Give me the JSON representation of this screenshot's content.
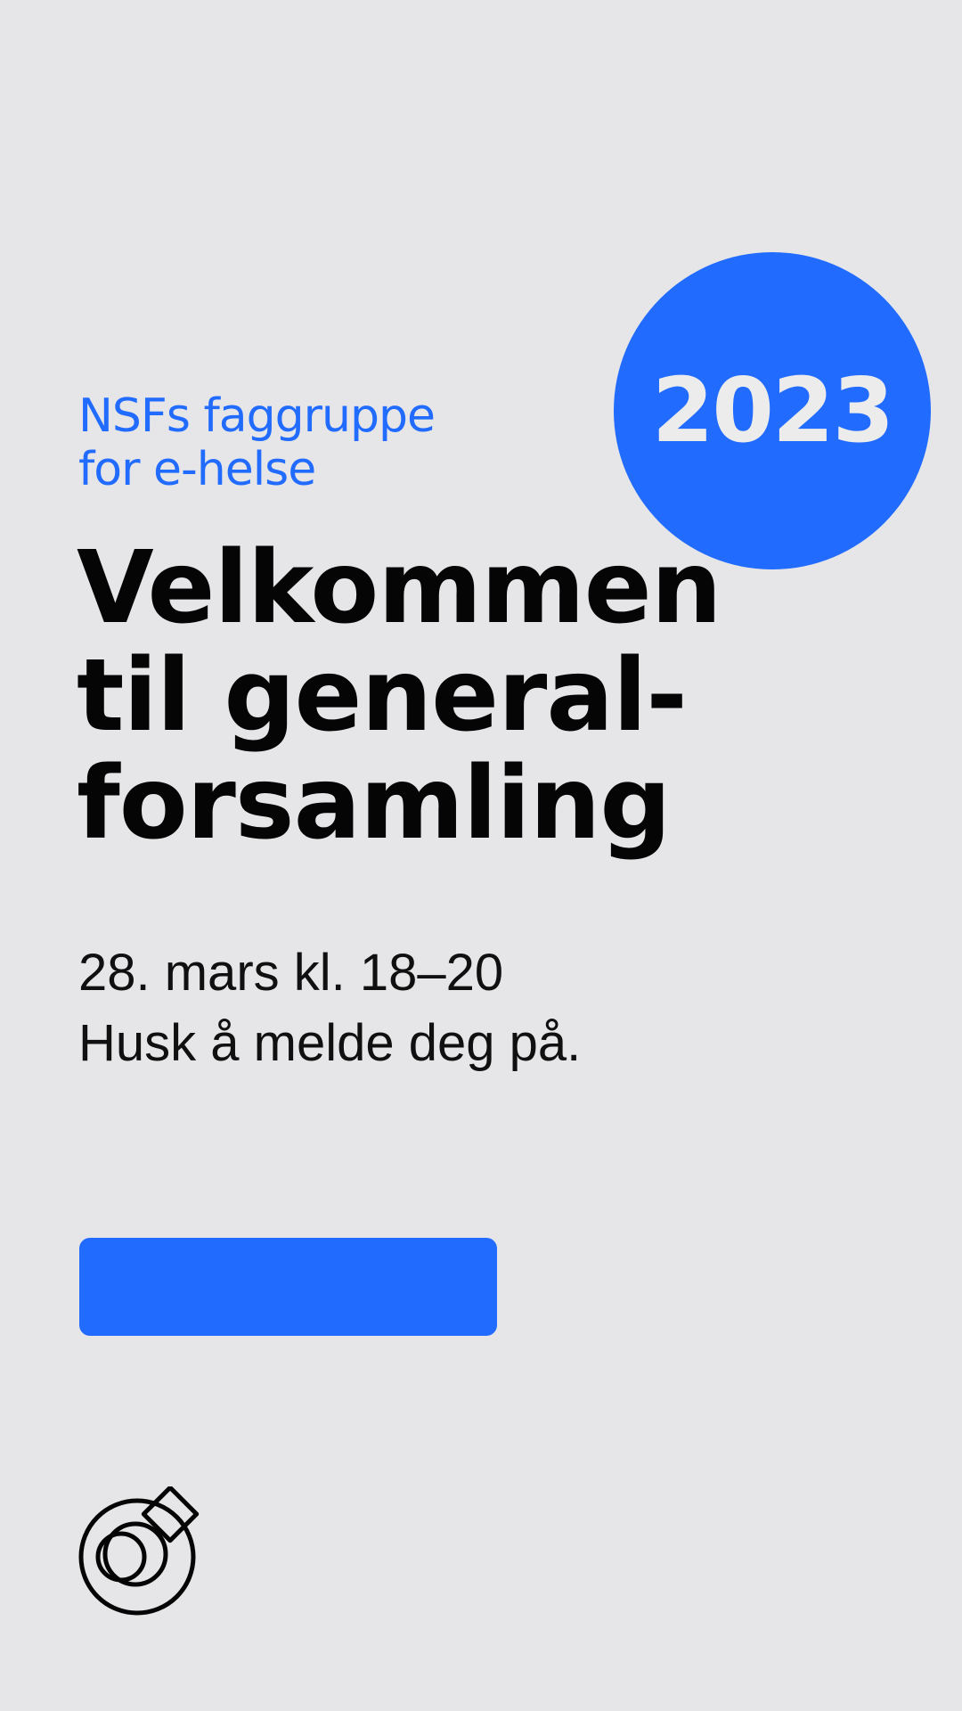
{
  "subtitle": {
    "line1": "NSFs faggruppe",
    "line2": "for e-helse"
  },
  "badge": {
    "year": "2023"
  },
  "headline": {
    "line1": "Velkommen",
    "line2": "til general-",
    "line3": "forsamling"
  },
  "event": {
    "datetime": "28. mars kl. 18–20",
    "reminder": "Husk å melde deg på."
  },
  "cta": {
    "label": ""
  },
  "logo": {
    "icon": "nsf-logo-icon"
  },
  "colors": {
    "accent": "#216bff",
    "background": "#e6e6e8",
    "text": "#050505",
    "badge_text": "#ececec"
  }
}
